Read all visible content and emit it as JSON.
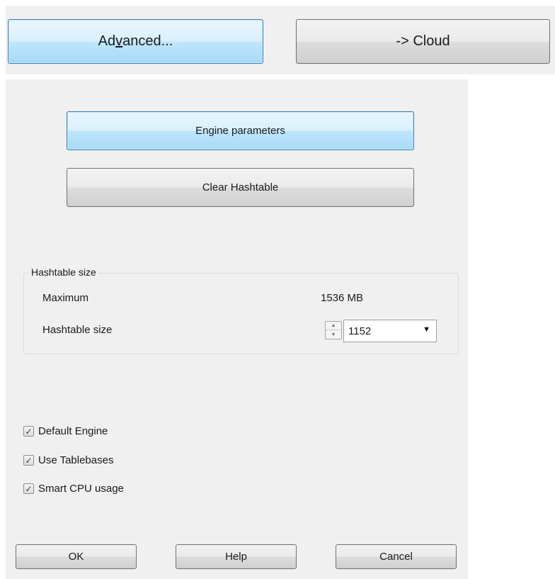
{
  "top_toolbar": {
    "advanced_label_pre": "Ad",
    "advanced_label_mnemonic": "v",
    "advanced_label_post": "anced...",
    "cloud_label": "-> Cloud"
  },
  "dialog": {
    "engine_parameters_label": "Engine parameters",
    "clear_hashtable_label": "Clear Hashtable",
    "hashtable_group": {
      "legend": "Hashtable size",
      "maximum_label": "Maximum",
      "maximum_value": "1536 MB",
      "size_label": "Hashtable size",
      "size_value": "1152",
      "spin_up_icon": "spin-up-arrow",
      "spin_down_icon": "spin-down-arrow",
      "dropdown_icon": "chevron-down"
    },
    "checkboxes": [
      {
        "label": "Default Engine",
        "checked": true
      },
      {
        "label": "Use Tablebases",
        "checked": true
      },
      {
        "label": "Smart CPU usage",
        "checked": true
      }
    ],
    "ok_label": "OK",
    "help_label": "Help",
    "cancel_label": "Cancel"
  },
  "colors": {
    "panel_bg": "#f0f0f0",
    "focus_border": "#3c7fb1",
    "focus_fill": "#bee6fd",
    "check_mark": "#1e395b"
  }
}
